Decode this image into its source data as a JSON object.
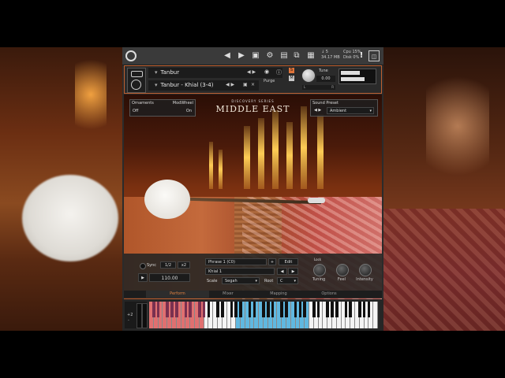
{
  "toolbar": {
    "buttons": [
      "prev-icon",
      "next-icon",
      "save-icon",
      "gear-icon",
      "rack-icon",
      "browser-icon",
      "cpu-icon"
    ],
    "stats": {
      "voices_label": "↓ 5",
      "memory": "34.17 MB",
      "cpu_label": "Cpu",
      "cpu_value": "15%",
      "disk_label": "Disk",
      "disk_value": "0%"
    }
  },
  "instrument": {
    "name": "Tanbur",
    "preset": "Tanbur - Khial (3-4)",
    "purge_label": "Purge",
    "tune_label": "Tune",
    "tune_value": "0.00",
    "s_label": "S",
    "m_label": "M",
    "l_label": "L",
    "r_label": "R"
  },
  "header": {
    "series": "DISCOVERY SERIES",
    "title": "MIDDLE EAST"
  },
  "ornaments": {
    "label": "Ornaments",
    "source": "ModWheel",
    "off": "Off",
    "on": "On"
  },
  "sound_preset": {
    "label": "Sound Preset",
    "value": "Ambient"
  },
  "perform": {
    "sync_label": "Sync",
    "half_label": "1/2",
    "double_label": "x2",
    "tempo": "110.00",
    "phrase": "Phrase 1 (C0)",
    "edit_label": "Edit",
    "khial": "Khial 1",
    "scale_label": "Scale",
    "scale_value": "Segah",
    "root_label": "Root",
    "root_value": "C",
    "knobs": [
      "Tuning",
      "Feel",
      "Intensity"
    ],
    "knobs_top_label": "Lock"
  },
  "tabs": [
    "Perform",
    "Mixer",
    "Mapping",
    "Options"
  ],
  "active_tab": "Perform",
  "keyboard": {
    "octave_label": "+2",
    "minus_label": "-"
  },
  "colors": {
    "accent": "#e08040",
    "red_keys": "#e07070",
    "blue_keys": "#60b8e0"
  }
}
